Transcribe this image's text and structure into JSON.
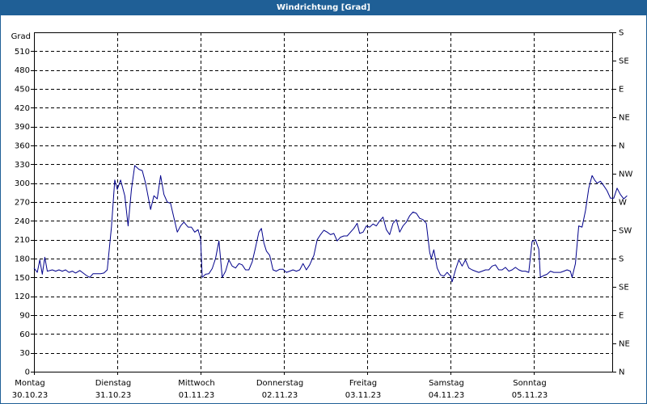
{
  "window": {
    "title": "Windrichtung [Grad]"
  },
  "colors": {
    "titlebar": "#1f5f96",
    "line": "#00008b",
    "grid": "#000000"
  },
  "chart_data": {
    "type": "line",
    "title": "Windrichtung [Grad]",
    "ylabel": "Grad",
    "ylim": [
      0,
      540
    ],
    "yticks": [
      0,
      30,
      60,
      90,
      120,
      150,
      180,
      210,
      240,
      270,
      300,
      330,
      360,
      390,
      420,
      450,
      480,
      510
    ],
    "right_axis_labels": [
      {
        "value": 0,
        "label": "N"
      },
      {
        "value": 45,
        "label": "NE"
      },
      {
        "value": 90,
        "label": "E"
      },
      {
        "value": 135,
        "label": "SE"
      },
      {
        "value": 180,
        "label": "S"
      },
      {
        "value": 225,
        "label": "SW"
      },
      {
        "value": 270,
        "label": "W"
      },
      {
        "value": 315,
        "label": "NW"
      },
      {
        "value": 360,
        "label": "N"
      },
      {
        "value": 405,
        "label": "NE"
      },
      {
        "value": 450,
        "label": "E"
      },
      {
        "value": 495,
        "label": "SE"
      },
      {
        "value": 540,
        "label": "S"
      }
    ],
    "x_unit": "days since 30.10.23 00:00",
    "xlim": [
      0,
      7
    ],
    "x_categories": [
      {
        "day": "Montag",
        "date": "30.10.23"
      },
      {
        "day": "Dienstag",
        "date": "31.10.23"
      },
      {
        "day": "Mittwoch",
        "date": "01.11.23"
      },
      {
        "day": "Donnerstag",
        "date": "02.11.23"
      },
      {
        "day": "Freitag",
        "date": "03.11.23"
      },
      {
        "day": "Samstag",
        "date": "04.11.23"
      },
      {
        "day": "Sonntag",
        "date": "05.11.23"
      }
    ],
    "grid": true,
    "series": [
      {
        "name": "Windrichtung",
        "points": [
          [
            0.0,
            165
          ],
          [
            0.04,
            158
          ],
          [
            0.07,
            178
          ],
          [
            0.1,
            155
          ],
          [
            0.13,
            182
          ],
          [
            0.16,
            160
          ],
          [
            0.22,
            162
          ],
          [
            0.26,
            160
          ],
          [
            0.3,
            162
          ],
          [
            0.34,
            160
          ],
          [
            0.38,
            162
          ],
          [
            0.42,
            158
          ],
          [
            0.46,
            160
          ],
          [
            0.5,
            157
          ],
          [
            0.55,
            161
          ],
          [
            0.59,
            157
          ],
          [
            0.63,
            153
          ],
          [
            0.67,
            150
          ],
          [
            0.71,
            156
          ],
          [
            0.75,
            156
          ],
          [
            0.8,
            156
          ],
          [
            0.84,
            157
          ],
          [
            0.88,
            162
          ],
          [
            0.93,
            230
          ],
          [
            0.97,
            305
          ],
          [
            1.0,
            290
          ],
          [
            1.04,
            305
          ],
          [
            1.09,
            280
          ],
          [
            1.13,
            232
          ],
          [
            1.17,
            290
          ],
          [
            1.21,
            328
          ],
          [
            1.26,
            322
          ],
          [
            1.3,
            320
          ],
          [
            1.34,
            300
          ],
          [
            1.4,
            258
          ],
          [
            1.44,
            280
          ],
          [
            1.48,
            275
          ],
          [
            1.52,
            312
          ],
          [
            1.56,
            282
          ],
          [
            1.6,
            270
          ],
          [
            1.64,
            268
          ],
          [
            1.68,
            245
          ],
          [
            1.72,
            222
          ],
          [
            1.76,
            232
          ],
          [
            1.8,
            238
          ],
          [
            1.85,
            230
          ],
          [
            1.89,
            230
          ],
          [
            1.93,
            222
          ],
          [
            1.97,
            226
          ],
          [
            2.0,
            212
          ],
          [
            2.02,
            150
          ],
          [
            2.06,
            155
          ],
          [
            2.1,
            156
          ],
          [
            2.14,
            164
          ],
          [
            2.18,
            180
          ],
          [
            2.22,
            208
          ],
          [
            2.26,
            150
          ],
          [
            2.3,
            160
          ],
          [
            2.34,
            178
          ],
          [
            2.38,
            168
          ],
          [
            2.42,
            165
          ],
          [
            2.46,
            172
          ],
          [
            2.5,
            170
          ],
          [
            2.54,
            162
          ],
          [
            2.58,
            162
          ],
          [
            2.62,
            175
          ],
          [
            2.66,
            198
          ],
          [
            2.7,
            222
          ],
          [
            2.73,
            228
          ],
          [
            2.76,
            205
          ],
          [
            2.79,
            192
          ],
          [
            2.83,
            185
          ],
          [
            2.87,
            162
          ],
          [
            2.91,
            160
          ],
          [
            2.95,
            163
          ],
          [
            2.99,
            163
          ],
          [
            3.03,
            158
          ],
          [
            3.07,
            160
          ],
          [
            3.11,
            162
          ],
          [
            3.15,
            160
          ],
          [
            3.19,
            162
          ],
          [
            3.23,
            172
          ],
          [
            3.27,
            162
          ],
          [
            3.31,
            170
          ],
          [
            3.36,
            185
          ],
          [
            3.4,
            210
          ],
          [
            3.44,
            218
          ],
          [
            3.48,
            225
          ],
          [
            3.52,
            222
          ],
          [
            3.56,
            218
          ],
          [
            3.6,
            220
          ],
          [
            3.64,
            208
          ],
          [
            3.68,
            214
          ],
          [
            3.72,
            216
          ],
          [
            3.76,
            216
          ],
          [
            3.8,
            222
          ],
          [
            3.84,
            228
          ],
          [
            3.88,
            236
          ],
          [
            3.91,
            220
          ],
          [
            3.95,
            222
          ],
          [
            3.99,
            232
          ],
          [
            4.03,
            230
          ],
          [
            4.07,
            235
          ],
          [
            4.11,
            232
          ],
          [
            4.15,
            240
          ],
          [
            4.19,
            246
          ],
          [
            4.23,
            226
          ],
          [
            4.27,
            218
          ],
          [
            4.31,
            236
          ],
          [
            4.35,
            242
          ],
          [
            4.39,
            222
          ],
          [
            4.43,
            232
          ],
          [
            4.47,
            238
          ],
          [
            4.51,
            248
          ],
          [
            4.55,
            254
          ],
          [
            4.59,
            252
          ],
          [
            4.63,
            244
          ],
          [
            4.67,
            242
          ],
          [
            4.71,
            236
          ],
          [
            4.75,
            190
          ],
          [
            4.77,
            180
          ],
          [
            4.8,
            194
          ],
          [
            4.84,
            165
          ],
          [
            4.88,
            154
          ],
          [
            4.92,
            152
          ],
          [
            4.96,
            158
          ],
          [
            5.0,
            152
          ],
          [
            5.02,
            143
          ],
          [
            5.06,
            162
          ],
          [
            5.1,
            178
          ],
          [
            5.14,
            168
          ],
          [
            5.18,
            178
          ],
          [
            5.22,
            165
          ],
          [
            5.26,
            162
          ],
          [
            5.3,
            160
          ],
          [
            5.34,
            158
          ],
          [
            5.38,
            160
          ],
          [
            5.42,
            162
          ],
          [
            5.46,
            162
          ],
          [
            5.5,
            168
          ],
          [
            5.54,
            170
          ],
          [
            5.58,
            162
          ],
          [
            5.62,
            162
          ],
          [
            5.66,
            166
          ],
          [
            5.7,
            160
          ],
          [
            5.74,
            162
          ],
          [
            5.78,
            166
          ],
          [
            5.82,
            162
          ],
          [
            5.86,
            160
          ],
          [
            5.9,
            160
          ],
          [
            5.94,
            158
          ],
          [
            5.98,
            207
          ],
          [
            6.02,
            210
          ],
          [
            6.06,
            195
          ],
          [
            6.08,
            150
          ],
          [
            6.12,
            153
          ],
          [
            6.16,
            155
          ],
          [
            6.2,
            160
          ],
          [
            6.24,
            158
          ],
          [
            6.28,
            158
          ],
          [
            6.32,
            158
          ],
          [
            6.36,
            160
          ],
          [
            6.4,
            162
          ],
          [
            6.44,
            160
          ],
          [
            6.46,
            150
          ],
          [
            6.5,
            172
          ],
          [
            6.54,
            232
          ],
          [
            6.58,
            230
          ],
          [
            6.62,
            256
          ],
          [
            6.66,
            292
          ],
          [
            6.7,
            312
          ],
          [
            6.73,
            305
          ],
          [
            6.76,
            300
          ],
          [
            6.8,
            303
          ],
          [
            6.84,
            296
          ],
          [
            6.88,
            288
          ],
          [
            6.92,
            276
          ],
          [
            6.96,
            276
          ],
          [
            7.0,
            292
          ],
          [
            7.04,
            282
          ],
          [
            7.08,
            275
          ],
          [
            7.12,
            280
          ]
        ]
      }
    ]
  }
}
